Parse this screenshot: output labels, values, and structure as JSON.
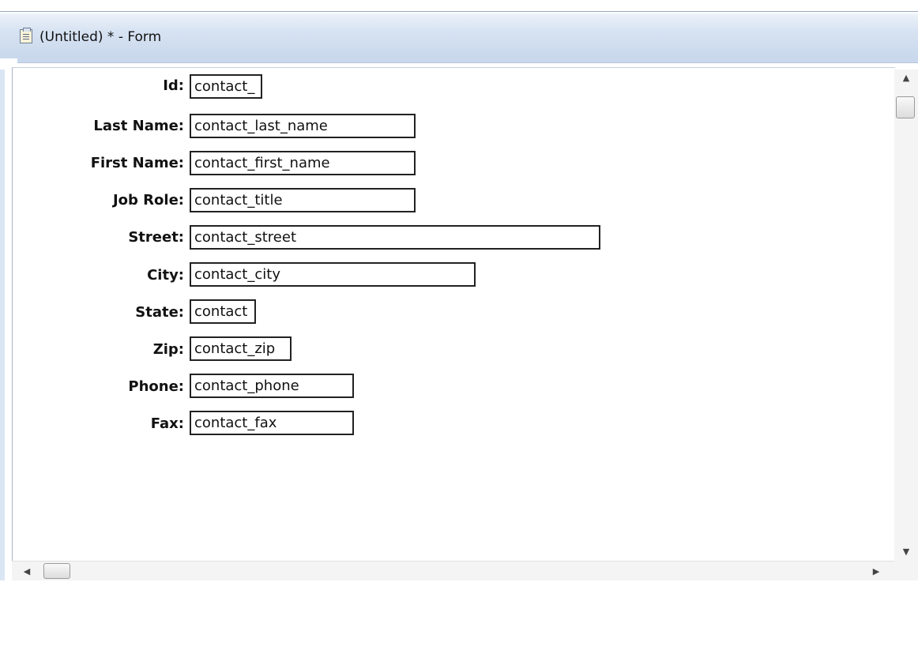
{
  "window": {
    "title": "(Untitled) * - Form",
    "icon": "form-document-icon"
  },
  "form": {
    "fields": [
      {
        "label": "Id:",
        "value": "contact_"
      },
      {
        "label": "Last Name:",
        "value": "contact_last_name"
      },
      {
        "label": "First Name:",
        "value": "contact_first_name"
      },
      {
        "label": "Job Role:",
        "value": "contact_title"
      },
      {
        "label": "Street:",
        "value": "contact_street"
      },
      {
        "label": "City:",
        "value": "contact_city"
      },
      {
        "label": "State:",
        "value": "contact"
      },
      {
        "label": "Zip:",
        "value": "contact_zip"
      },
      {
        "label": "Phone:",
        "value": "contact_phone"
      },
      {
        "label": "Fax:",
        "value": "contact_fax"
      }
    ]
  },
  "scrollbars": {
    "vertical": {
      "up_icon": "arrow-up-icon",
      "down_icon": "arrow-down-icon"
    },
    "horizontal": {
      "left_icon": "arrow-left-icon",
      "right_icon": "arrow-right-icon"
    }
  }
}
